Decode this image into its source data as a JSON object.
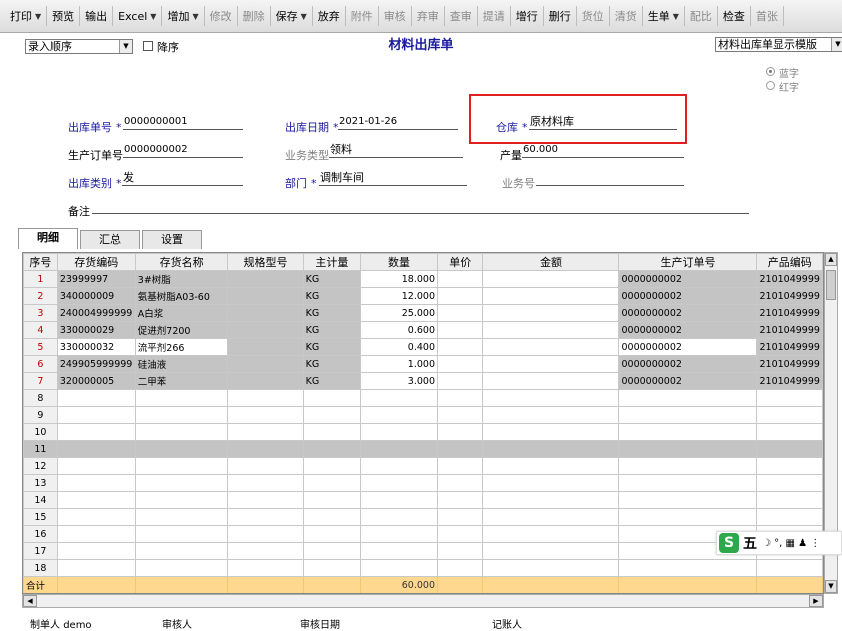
{
  "toolbar": {
    "buttons": [
      {
        "label": "打印",
        "enabled": true,
        "arrow": true
      },
      {
        "label": "预览",
        "enabled": true,
        "arrow": false
      },
      {
        "label": "输出",
        "enabled": true,
        "arrow": false
      },
      {
        "label": "Excel",
        "enabled": true,
        "arrow": true
      },
      {
        "label": "增加",
        "enabled": true,
        "arrow": true
      },
      {
        "label": "修改",
        "enabled": false,
        "arrow": false
      },
      {
        "label": "删除",
        "enabled": false,
        "arrow": false
      },
      {
        "label": "保存",
        "enabled": true,
        "arrow": true
      },
      {
        "label": "放弃",
        "enabled": true,
        "arrow": false
      },
      {
        "label": "附件",
        "enabled": false,
        "arrow": false
      },
      {
        "label": "审核",
        "enabled": false,
        "arrow": false
      },
      {
        "label": "弃审",
        "enabled": false,
        "arrow": false
      },
      {
        "label": "查审",
        "enabled": false,
        "arrow": false
      },
      {
        "label": "提请",
        "enabled": false,
        "arrow": false
      },
      {
        "label": "增行",
        "enabled": true,
        "arrow": false
      },
      {
        "label": "删行",
        "enabled": true,
        "arrow": false
      },
      {
        "label": "货位",
        "enabled": false,
        "arrow": false
      },
      {
        "label": "清货",
        "enabled": false,
        "arrow": false
      },
      {
        "label": "生单",
        "enabled": true,
        "arrow": true
      },
      {
        "label": "配比",
        "enabled": false,
        "arrow": false
      },
      {
        "label": "检查",
        "enabled": true,
        "arrow": false
      },
      {
        "label": "首张",
        "enabled": false,
        "arrow": false
      }
    ]
  },
  "form": {
    "title": "材料出库单",
    "sort_select": "录入顺序",
    "desc_label": "降序",
    "template_select": "材料出库单显示模版",
    "radio_blue": "蓝字",
    "radio_red": "红字",
    "req_mark": "*",
    "fields": {
      "out_no_label": "出库单号",
      "out_no": "0000000001",
      "out_date_label": "出库日期",
      "out_date": "2021-01-26",
      "warehouse_label": "仓库",
      "warehouse": "原材料库",
      "prod_order_label": "生产订单号",
      "prod_order": "0000000002",
      "biz_type_label": "业务类型",
      "biz_type": "领料",
      "output_label": "产量",
      "output": "60.000",
      "out_type_label": "出库类别",
      "out_type": "发",
      "dept_label": "部门",
      "dept": "调制车间",
      "biz_no_label": "业务号",
      "biz_no": "",
      "remark_label": "备注",
      "remark": ""
    }
  },
  "tabs": [
    {
      "label": "明细",
      "active": true
    },
    {
      "label": "汇总",
      "active": false
    },
    {
      "label": "设置",
      "active": false
    }
  ],
  "grid": {
    "columns": [
      "序号",
      "存货编码",
      "存货名称",
      "规格型号",
      "主计量",
      "数量",
      "单价",
      "金额",
      "生产订单号",
      "产品编码"
    ],
    "rows": [
      {
        "no": "1",
        "code": "23999997",
        "name": "3#树脂",
        "spec": "",
        "unit": "KG",
        "qty": "18.000",
        "price": "",
        "amount": "",
        "order": "0000000002",
        "prod": "2101049999"
      },
      {
        "no": "2",
        "code": "340000009",
        "name": "氨基树脂A03-60",
        "spec": "",
        "unit": "KG",
        "qty": "12.000",
        "price": "",
        "amount": "",
        "order": "0000000002",
        "prod": "2101049999"
      },
      {
        "no": "3",
        "code": "240004999999",
        "name": "A白浆",
        "spec": "",
        "unit": "KG",
        "qty": "25.000",
        "price": "",
        "amount": "",
        "order": "0000000002",
        "prod": "2101049999"
      },
      {
        "no": "4",
        "code": "330000029",
        "name": "促进剂7200",
        "spec": "",
        "unit": "KG",
        "qty": "0.600",
        "price": "",
        "amount": "",
        "order": "0000000002",
        "prod": "2101049999"
      },
      {
        "no": "5",
        "code": "330000032",
        "name": "流平剂266",
        "spec": "",
        "unit": "KG",
        "qty": "0.400",
        "price": "",
        "amount": "",
        "order": "0000000002",
        "prod": "2101049999"
      },
      {
        "no": "6",
        "code": "249905999999",
        "name": "硅油液",
        "spec": "",
        "unit": "KG",
        "qty": "1.000",
        "price": "",
        "amount": "",
        "order": "0000000002",
        "prod": "2101049999"
      },
      {
        "no": "7",
        "code": "320000005",
        "name": "二甲苯",
        "spec": "",
        "unit": "KG",
        "qty": "3.000",
        "price": "",
        "amount": "",
        "order": "0000000002",
        "prod": "2101049999"
      }
    ],
    "empty_rows": [
      "8",
      "9",
      "10",
      "11",
      "12",
      "13",
      "14",
      "15",
      "16",
      "17",
      "18"
    ],
    "total_label": "合计",
    "total_qty": "60.000"
  },
  "footer": {
    "maker_label": "制单人",
    "maker": "demo",
    "auditor_label": "审核人",
    "audit_date_label": "审核日期",
    "bookkeeper_label": "记账人"
  },
  "ime": {
    "logo": "S",
    "mode": "五",
    "icons": "☽ °, ▦ ♟ ⋮"
  },
  "colors": {
    "label_blue": "#1a1aa0",
    "row_no_red": "#c00000",
    "total_bg": "#ffd890",
    "highlight": "#e02020"
  }
}
